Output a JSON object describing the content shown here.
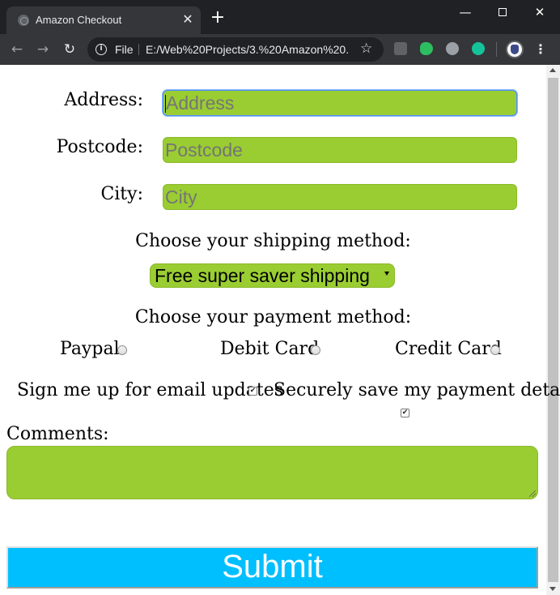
{
  "browser": {
    "tab_title": "Amazon Checkout",
    "tab_close": "✕",
    "new_tab": "+",
    "scheme": "File",
    "url": "E:/Web%20Projects/3.%20Amazon%20...",
    "window_controls": {
      "minimize": "—",
      "close": "✕"
    }
  },
  "form": {
    "address": {
      "label": "Address:",
      "placeholder": "Address",
      "value": ""
    },
    "postcode": {
      "label": "Postcode:",
      "placeholder": "Postcode",
      "value": ""
    },
    "city": {
      "label": "City:",
      "placeholder": "City",
      "value": ""
    },
    "shipping": {
      "prompt": "Choose your shipping method:",
      "selected": "Free super saver shipping"
    },
    "payment": {
      "prompt": "Choose your payment method:",
      "options": [
        "Paypal",
        "Debit Card",
        "Credit Card"
      ]
    },
    "email_updates": {
      "label": "Sign me up for email updates",
      "checked": true
    },
    "save_payment": {
      "label": "Securely save my payment details",
      "checked": true
    },
    "comments": {
      "label": "Comments:",
      "value": ""
    },
    "submit_label": "Submit"
  },
  "colors": {
    "field_bg": "#9acd32",
    "submit_bg": "#00bfff",
    "chrome_dark": "#202124",
    "chrome_toolbar": "#35363a"
  }
}
